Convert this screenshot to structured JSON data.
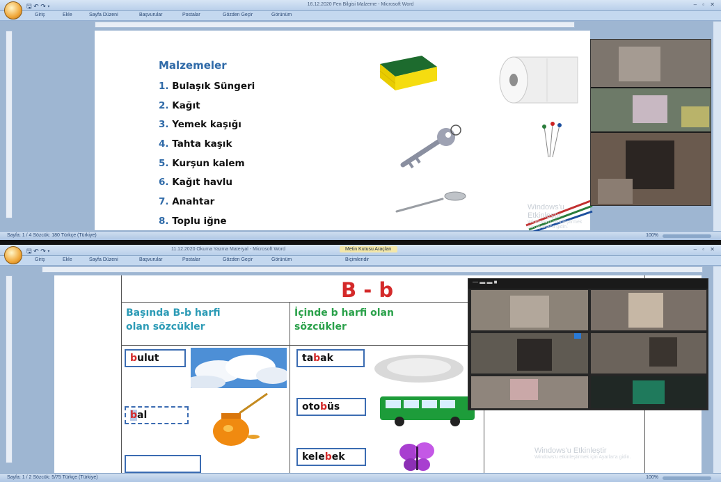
{
  "window1": {
    "title": "16.12.2020 Fen Bilgisi Malzeme - Microsoft Word",
    "qat": "🖫 ↶ ↷ ▾",
    "tabs": [
      "Giriş",
      "Ekle",
      "Sayfa Düzeni",
      "Başvurular",
      "Postalar",
      "Gözden Geçir",
      "Görünüm"
    ],
    "status": "Sayfa: 1 / 4    Sözcük: 180    Türkçe (Türkiye)",
    "status_right": "100%",
    "heading": "Malzemeler",
    "items": [
      {
        "num": "1.",
        "text": "Bulaşık Süngeri"
      },
      {
        "num": "2.",
        "text": "Kağıt"
      },
      {
        "num": "3.",
        "text": "Yemek kaşığı"
      },
      {
        "num": "4.",
        "text": "Tahta kaşık"
      },
      {
        "num": "5.",
        "text": "Kurşun kalem"
      },
      {
        "num": "6.",
        "text": "Kağıt havlu"
      },
      {
        "num": "7.",
        "text": "Anahtar"
      },
      {
        "num": "8.",
        "text": "Toplu iğne"
      }
    ],
    "watermark_title": "Windows'u Etkinleştir",
    "watermark_sub": "Windows'u etkinleştirmek için Ayarlar'a gidin."
  },
  "window2": {
    "title": "11.12.2020 Okuma Yazma Materyal - Microsoft Word",
    "context_title": "Metin Kutusu Araçları",
    "qat": "🖫 ↶ ↷ ▾",
    "tabs": [
      "Giriş",
      "Ekle",
      "Sayfa Düzeni",
      "Başvurular",
      "Postalar",
      "Gözden Geçir",
      "Görünüm",
      "Biçimlendir"
    ],
    "status": "Sayfa: 1 / 2    Sözcük: 5/75    Türkçe (Türkiye)",
    "status_right": "100%",
    "heading": "B - b",
    "col1_head": [
      "Başında B-b harfi",
      "olan sözcükler"
    ],
    "col2_head": [
      "İçinde b harfi olan",
      "sözcükler"
    ],
    "col1_words": [
      {
        "pre": "",
        "hl": "b",
        "post": "ulut"
      },
      {
        "pre": "",
        "hl": "b",
        "post": "al"
      }
    ],
    "col2_words": [
      {
        "pre": "ta",
        "hl": "b",
        "post": "ak"
      },
      {
        "pre": "oto",
        "hl": "b",
        "post": "üs"
      },
      {
        "pre": "kele",
        "hl": "b",
        "post": "ek"
      }
    ],
    "watermark_title": "Windows'u Etkinleştir",
    "watermark_sub": "Windows'u etkinleştirmek için Ayarlar'a gidin."
  },
  "colors": {
    "accent_blue": "#2f6aa8",
    "highlight_red": "#d42a2a",
    "header_teal": "#2c9bb6",
    "header_green": "#2aa14a"
  }
}
